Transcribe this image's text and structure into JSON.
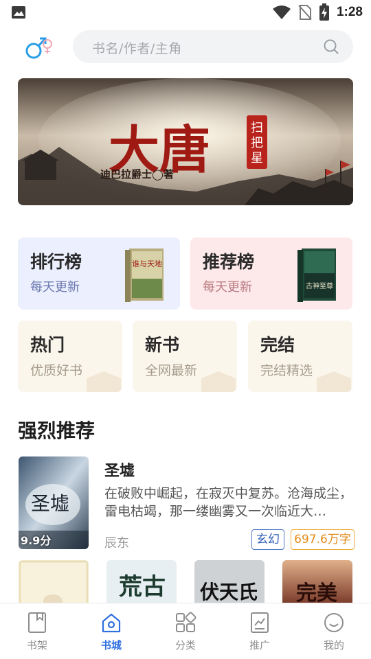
{
  "status_bar": {
    "time": "1:28",
    "icons": [
      "image-icon",
      "wifi-icon",
      "no-sim-icon",
      "battery-charging-icon"
    ]
  },
  "header": {
    "gender_icon": "gender-switch-icon",
    "search_placeholder": "书名/作者/主角"
  },
  "banner": {
    "title": "大唐",
    "seal": "扫把星",
    "author": "迪巴拉爵士◯著"
  },
  "rank_cards": [
    {
      "title": "排行榜",
      "subtitle": "每天更新",
      "book_text": "谁与天地"
    },
    {
      "title": "推荐榜",
      "subtitle": "每天更新",
      "book_text": "古神至尊"
    }
  ],
  "category_cards": [
    {
      "title": "热门",
      "subtitle": "优质好书"
    },
    {
      "title": "新书",
      "subtitle": "全网最新"
    },
    {
      "title": "完结",
      "subtitle": "完结精选"
    }
  ],
  "section": {
    "title": "强烈推荐"
  },
  "featured": {
    "name": "圣墟",
    "description": "在破败中崛起，在寂灭中复苏。沧海成尘，雷电枯竭，那一缕幽雾又一次临近大…",
    "author": "辰东",
    "score": "9.9分",
    "genre_tag": "玄幻",
    "words_tag": "697.6万字",
    "cover_text": "圣墟"
  },
  "more_books": [
    {
      "cover_text": ""
    },
    {
      "cover_text": "荒古"
    },
    {
      "cover_text": "伏天氏"
    },
    {
      "cover_text": "完美"
    }
  ],
  "tabs": [
    {
      "label": "书架",
      "icon": "bookshelf-icon",
      "active": false
    },
    {
      "label": "书城",
      "icon": "bookstore-icon",
      "active": true
    },
    {
      "label": "分类",
      "icon": "category-icon",
      "active": false
    },
    {
      "label": "推广",
      "icon": "promotion-icon",
      "active": false
    },
    {
      "label": "我的",
      "icon": "profile-icon",
      "active": false
    }
  ],
  "colors": {
    "accent": "#2f6fe0",
    "tab_inactive": "#8d8d8d",
    "ranking_bg": "#eceffd",
    "recommend_bg": "#fde8ea",
    "category_bg": "#fbf6ec"
  }
}
